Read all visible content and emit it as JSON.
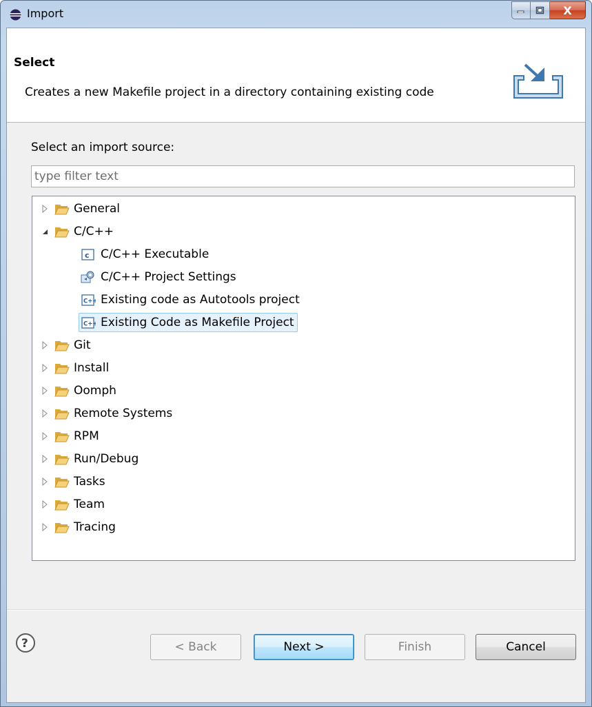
{
  "window": {
    "title": "Import",
    "icon": "eclipse-icon",
    "controls": [
      "minimize-icon",
      "maximize-icon",
      "close-icon"
    ],
    "close_label": "X"
  },
  "header": {
    "title": "Select",
    "description": "Creates a new Makefile project in a directory containing existing code",
    "image": "import-wizard-icon"
  },
  "source": {
    "label": "Select an import source:",
    "filter_placeholder": "type filter text"
  },
  "tree": {
    "items": [
      {
        "label": "General",
        "type": "folder",
        "expanded": false
      },
      {
        "label": "C/C++",
        "type": "folder",
        "expanded": true
      },
      {
        "label": "C/C++ Executable",
        "type": "c-executable-icon",
        "child": true
      },
      {
        "label": "C/C++ Project Settings",
        "type": "project-settings-icon",
        "child": true
      },
      {
        "label": "Existing code as Autotools project",
        "type": "cpp-file-icon",
        "child": true
      },
      {
        "label": "Existing Code as Makefile Project",
        "type": "cpp-file-icon",
        "child": true,
        "selected": true
      },
      {
        "label": "Git",
        "type": "folder",
        "expanded": false
      },
      {
        "label": "Install",
        "type": "folder",
        "expanded": false
      },
      {
        "label": "Oomph",
        "type": "folder",
        "expanded": false
      },
      {
        "label": "Remote Systems",
        "type": "folder",
        "expanded": false
      },
      {
        "label": "RPM",
        "type": "folder",
        "expanded": false
      },
      {
        "label": "Run/Debug",
        "type": "folder",
        "expanded": false
      },
      {
        "label": "Tasks",
        "type": "folder",
        "expanded": false
      },
      {
        "label": "Team",
        "type": "folder",
        "expanded": false
      },
      {
        "label": "Tracing",
        "type": "folder",
        "expanded": false
      }
    ]
  },
  "footer": {
    "help_icon": "help-icon",
    "back_label": "< Back",
    "next_label": "Next >",
    "finish_label": "Finish",
    "cancel_label": "Cancel"
  },
  "colors": {
    "selection_bg": "#e5f1fb",
    "selection_border": "#99c9ef",
    "folder": "#e8b84a",
    "default_button": "#bee6fd"
  }
}
